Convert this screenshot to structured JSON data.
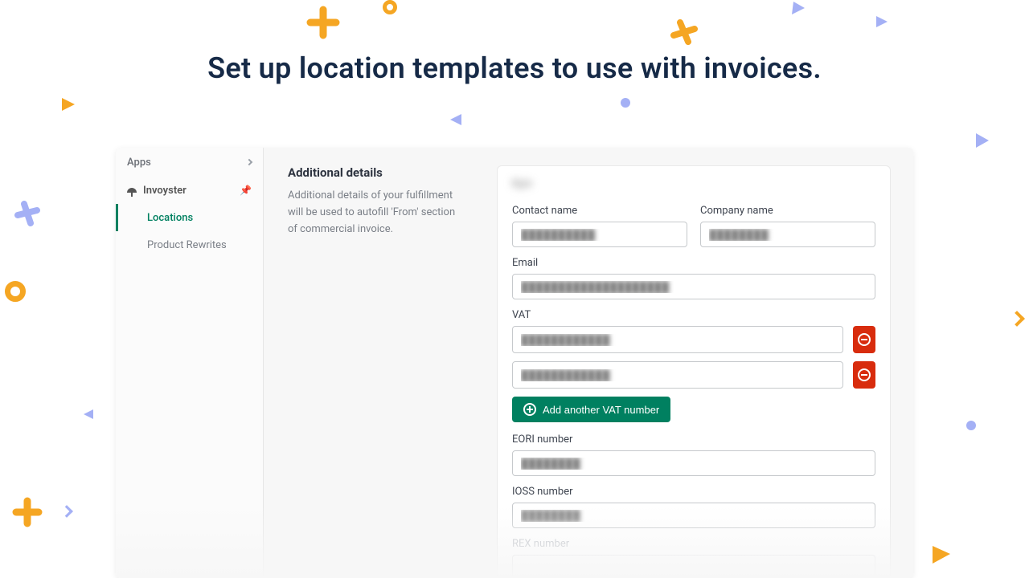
{
  "headline": "Set up location templates to use with invoices.",
  "sidebar": {
    "header": "Apps",
    "app": "Invoyster",
    "items": [
      {
        "label": "Locations",
        "active": true
      },
      {
        "label": "Product Rewrites",
        "active": false
      }
    ]
  },
  "left": {
    "title": "Additional details",
    "description": "Additional details of your fulfillment will be used to autofill 'From' section of commercial invoice."
  },
  "form": {
    "contact_name": {
      "label": "Contact name",
      "value": "██████████"
    },
    "company_name": {
      "label": "Company name",
      "value": "████████"
    },
    "email": {
      "label": "Email",
      "value": "████████████████████"
    },
    "vat": {
      "label": "VAT",
      "values": [
        "████████████",
        "████████████"
      ]
    },
    "add_vat_label": "Add another VAT number",
    "eori": {
      "label": "EORI number",
      "value": "████████"
    },
    "ioss": {
      "label": "IOSS number",
      "value": "████████"
    },
    "rex": {
      "label": "REX number",
      "value": ""
    }
  }
}
